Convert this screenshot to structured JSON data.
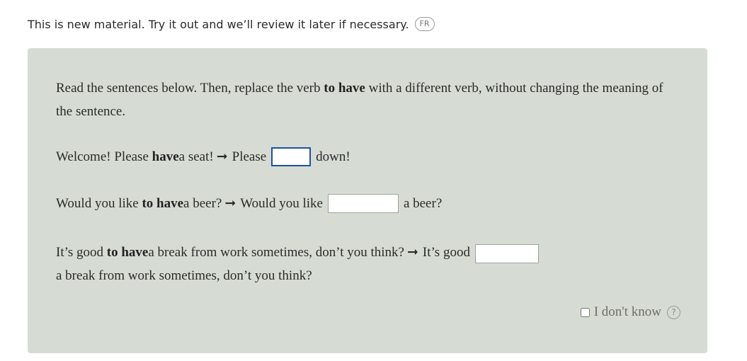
{
  "notice": {
    "text": "This is new material. Try it out and we’ll review it later if necessary.",
    "badge": "FR"
  },
  "instructions": {
    "part1": "Read the sentences below. Then, replace the verb ",
    "bold": "to have",
    "part2": " with a different verb, without changing the meaning of the sentence."
  },
  "arrow": "➞",
  "exercises": [
    {
      "before_plain": "Welcome! Please ",
      "before_bold": "have",
      "before_rest": " a seat!",
      "prompt": "Please",
      "after": "down!"
    },
    {
      "before_plain": "Would you like ",
      "before_bold": "to have",
      "before_rest": " a beer?",
      "prompt": "Would you like",
      "after": "a beer?"
    },
    {
      "before_plain": "It’s good ",
      "before_bold": "to have",
      "before_rest": " a break from work sometimes, don’t you think?",
      "prompt": "It’s good",
      "after": "a break from work sometimes, don’t you think?"
    }
  ],
  "inputs": [
    "",
    "",
    ""
  ],
  "idk": {
    "label": "I don't know",
    "help": "?",
    "checked": false
  }
}
